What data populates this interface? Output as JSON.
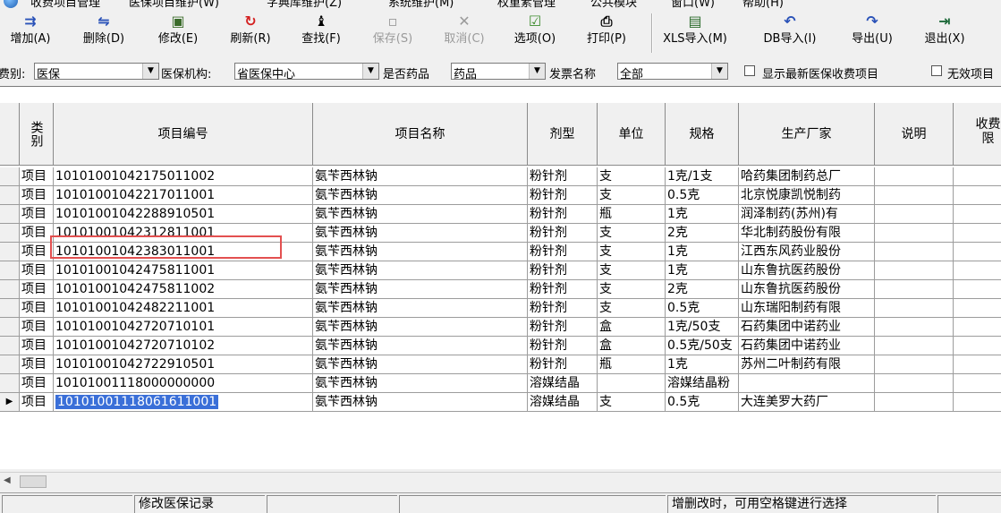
{
  "menu": {
    "items": [
      "收费项目管理",
      "医保项目维护(W)",
      "字典库维护(Z)",
      "系统维护(M)",
      "权重素管理",
      "公共模块",
      "窗口(W)",
      "帮助(H)"
    ]
  },
  "toolbar": {
    "add": {
      "label": "增加(A)",
      "icon": "add-icon"
    },
    "delete": {
      "label": "删除(D)",
      "icon": "delete-icon"
    },
    "modify": {
      "label": "修改(E)",
      "icon": "edit-icon"
    },
    "refresh": {
      "label": "刷新(R)",
      "icon": "refresh-icon"
    },
    "find": {
      "label": "查找(F)",
      "icon": "binoculars-icon"
    },
    "save": {
      "label": "保存(S)",
      "icon": "save-icon"
    },
    "cancel": {
      "label": "取消(C)",
      "icon": "cancel-icon"
    },
    "options": {
      "label": "选项(O)",
      "icon": "options-icon"
    },
    "print": {
      "label": "打印(P)",
      "icon": "printer-icon"
    },
    "xls_import": {
      "label": "XLS导入(M)",
      "icon": "xls-import-icon"
    },
    "db_import": {
      "label": "DB导入(I)",
      "icon": "db-import-icon"
    },
    "export": {
      "label": "导出(U)",
      "icon": "export-icon"
    },
    "exit": {
      "label": "退出(X)",
      "icon": "exit-icon"
    }
  },
  "filters": {
    "fee_category_label": "费别:",
    "fee_category_value": "医保",
    "insurer_label": "医保机构:",
    "insurer_value": "省医保中心",
    "is_drug_label": "是否药品",
    "is_drug_value": "药品",
    "invoice_label": "发票名称",
    "invoice_value": "全部",
    "show_latest_label": "显示最新医保收费项目",
    "invalid_label": "无效项目"
  },
  "table": {
    "columns": [
      "类别",
      "项目编号",
      "项目名称",
      "剂型",
      "单位",
      "规格",
      "生产厂家",
      "说明",
      "收费限"
    ],
    "rows": [
      [
        "项目",
        "10101001042175011002",
        "氨苄西林钠",
        "粉针剂",
        "支",
        "1克/1支",
        "哈药集团制药总厂"
      ],
      [
        "项目",
        "10101001042217011001",
        "氨苄西林钠",
        "粉针剂",
        "支",
        "0.5克",
        "北京悦康凯悦制药"
      ],
      [
        "项目",
        "10101001042288910501",
        "氨苄西林钠",
        "粉针剂",
        "瓶",
        "1克",
        "润泽制药(苏州)有"
      ],
      [
        "项目",
        "10101001042312811001",
        "氨苄西林钠",
        "粉针剂",
        "支",
        "2克",
        "华北制药股份有限"
      ],
      [
        "项目",
        "10101001042383011001",
        "氨苄西林钠",
        "粉针剂",
        "支",
        "1克",
        "江西东风药业股份"
      ],
      [
        "项目",
        "10101001042475811001",
        "氨苄西林钠",
        "粉针剂",
        "支",
        "1克",
        "山东鲁抗医药股份"
      ],
      [
        "项目",
        "10101001042475811002",
        "氨苄西林钠",
        "粉针剂",
        "支",
        "2克",
        "山东鲁抗医药股份"
      ],
      [
        "项目",
        "10101001042482211001",
        "氨苄西林钠",
        "粉针剂",
        "支",
        "0.5克",
        "山东瑞阳制药有限"
      ],
      [
        "项目",
        "10101001042720710101",
        "氨苄西林钠",
        "粉针剂",
        "盒",
        "1克/50支",
        "石药集团中诺药业"
      ],
      [
        "项目",
        "10101001042720710102",
        "氨苄西林钠",
        "粉针剂",
        "盒",
        "0.5克/50支",
        "石药集团中诺药业"
      ],
      [
        "项目",
        "10101001042722910501",
        "氨苄西林钠",
        "粉针剂",
        "瓶",
        "1克",
        "苏州二叶制药有限"
      ],
      [
        "项目",
        "10101001118000000000",
        "氨苄西林钠",
        "溶媒结晶",
        "",
        "溶媒结晶粉",
        ""
      ],
      [
        "项目",
        "10101001118061611001",
        "氨苄西林钠",
        "溶媒结晶",
        "支",
        "0.5克",
        "大连美罗大药厂"
      ]
    ],
    "selected_row": 12
  },
  "status": {
    "panel1": "",
    "panel2": "修改医保记录",
    "panel3": "",
    "panel4": "增删改时，可用空格键进行选择",
    "panel5": ""
  }
}
